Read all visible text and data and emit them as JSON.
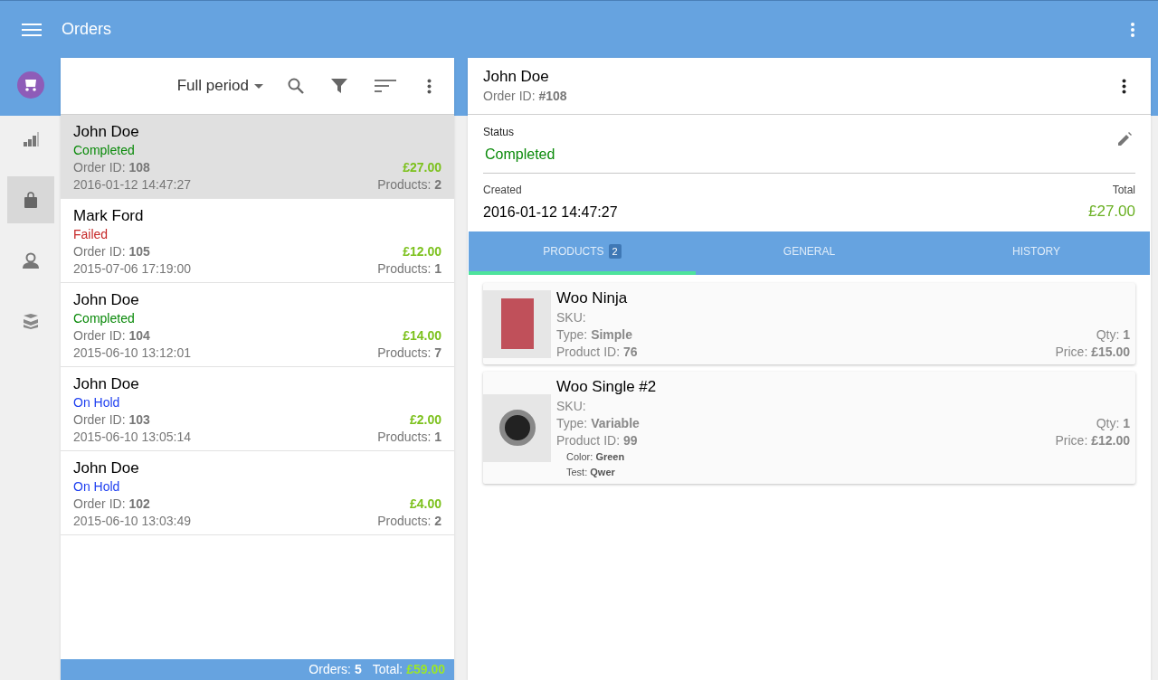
{
  "app_bar": {
    "title": "Orders"
  },
  "nav_rail": [
    {
      "kind": "chart",
      "selected": false
    },
    {
      "kind": "bag",
      "selected": true
    },
    {
      "kind": "person",
      "selected": false
    },
    {
      "kind": "boxes",
      "selected": false
    }
  ],
  "orders_list": {
    "period": "Full period",
    "orders": [
      {
        "name": "John Doe",
        "status": "Completed",
        "color": "#0a8a0a",
        "order_id": "Order ID: **108**",
        "total": "£27.00",
        "date": "2016-01-12 14:47:27",
        "products": "Products: **2**",
        "selected": true
      },
      {
        "name": "Mark Ford",
        "status": "Failed",
        "color": "#c62828",
        "order_id": "Order ID: **105**",
        "total": "£12.00",
        "date": "2015-07-06 17:19:00",
        "products": "Products: **1**",
        "selected": false
      },
      {
        "name": "John Doe",
        "status": "Completed",
        "color": "#0a8a0a",
        "order_id": "Order ID: **104**",
        "total": "£14.00",
        "date": "2015-06-10 13:12:01",
        "products": "Products: **7**",
        "selected": false
      },
      {
        "name": "John Doe",
        "status": "On Hold",
        "color": "#1e3ff0",
        "order_id": "Order ID: **103**",
        "total": "£2.00",
        "date": "2015-06-10 13:05:14",
        "products": "Products: **1**",
        "selected": false
      },
      {
        "name": "John Doe",
        "status": "On Hold",
        "color": "#1e3ff0",
        "order_id": "Order ID: **102**",
        "total": "£4.00",
        "date": "2015-06-10 13:03:49",
        "products": "Products: **2**",
        "selected": false
      }
    ],
    "footer": {
      "orders": "Orders: **5**",
      "total_label": "Total:",
      "total": "£59.00"
    }
  },
  "detail": {
    "name": "John Doe",
    "order_id": "Order ID: **#108**",
    "status_label": "Status",
    "status": "Completed",
    "created_label": "Created",
    "created": "2016-01-12 14:47:27",
    "total_label": "Total",
    "total": "£27.00",
    "tabs": [
      {
        "label": "PRODUCTS",
        "badge": "2",
        "selected": true
      },
      {
        "label": "GENERAL",
        "selected": false
      },
      {
        "label": "HISTORY",
        "selected": false
      }
    ],
    "products": [
      {
        "name": "Woo Ninja",
        "sku": "SKU:",
        "type": "Type: **Simple**",
        "product_id": "Product ID: **76**",
        "qty": "Qty: **1**",
        "price": "Price: **£15.00**"
      },
      {
        "name": "Woo Single #2",
        "sku": "SKU:",
        "type": "Type: **Variable**",
        "product_id": "Product ID: **99**",
        "qty": "Qty: **1**",
        "price": "Price: **£12.00**",
        "attributes": [
          "Color: **Green**",
          "Test: **Qwer**"
        ]
      }
    ]
  }
}
